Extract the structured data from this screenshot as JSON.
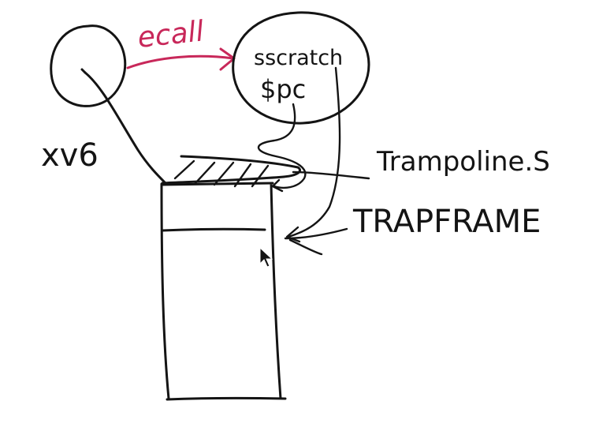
{
  "labels": {
    "ecall": "ecall",
    "sscratch": "sscratch",
    "pc": "$pc",
    "xv6": "xv6",
    "trampoline": "Trampoline.S",
    "trapframe": "TRAPFRAME"
  },
  "colors": {
    "ink": "#141414",
    "accent": "#c8285a",
    "background": "#ffffff"
  },
  "icons": {
    "cursor": "mouse-pointer-icon"
  }
}
